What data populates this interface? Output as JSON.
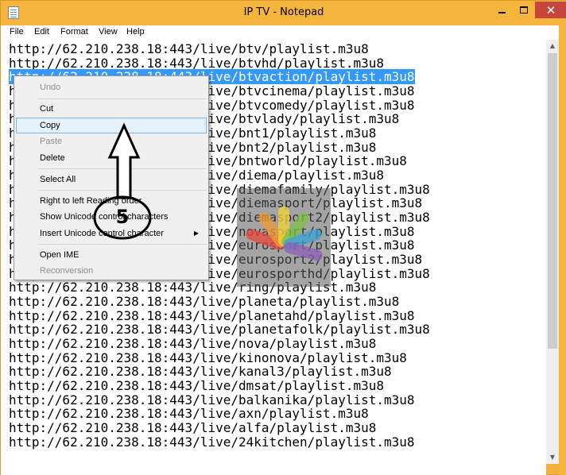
{
  "window": {
    "title": "IP TV - Notepad",
    "close_symbol": "✕"
  },
  "menubar": {
    "items": [
      "File",
      "Edit",
      "Format",
      "View",
      "Help"
    ]
  },
  "editor": {
    "selection": "http://62.210.238.18:443/live/btvaction/playlist.m3u8",
    "lines": [
      "http://62.210.238.18:443/live/btv/playlist.m3u8",
      "http://62.210.238.18:443/live/btvhd/playlist.m3u8",
      "http://62.210.238.18:443/live/btvaction/playlist.m3u8",
      "http://62.210.238.18:443/live/btvcinema/playlist.m3u8",
      "http://62.210.238.18:443/live/btvcomedy/playlist.m3u8",
      "http://62.210.238.18:443/live/btvlady/playlist.m3u8",
      "http://62.210.238.18:443/live/bnt1/playlist.m3u8",
      "http://62.210.238.18:443/live/bnt2/playlist.m3u8",
      "http://62.210.238.18:443/live/bntworld/playlist.m3u8",
      "http://62.210.238.18:443/live/diema/playlist.m3u8",
      "http://62.210.238.18:443/live/diemafamily/playlist.m3u8",
      "http://62.210.238.18:443/live/diemasport/playlist.m3u8",
      "http://62.210.238.18:443/live/diemasport2/playlist.m3u8",
      "http://62.210.238.18:443/live/novasport/playlist.m3u8",
      "http://62.210.238.18:443/live/eurosport/playlist.m3u8",
      "http://62.210.238.18:443/live/eurosport2/playlist.m3u8",
      "http://62.210.238.18:443/live/eurosporthd/playlist.m3u8",
      "http://62.210.238.18:443/live/ring/playlist.m3u8",
      "http://62.210.238.18:443/live/planeta/playlist.m3u8",
      "http://62.210.238.18:443/live/planetahd/playlist.m3u8",
      "http://62.210.238.18:443/live/planetafolk/playlist.m3u8",
      "http://62.210.238.18:443/live/nova/playlist.m3u8",
      "http://62.210.238.18:443/live/kinonova/playlist.m3u8",
      "http://62.210.238.18:443/live/kanal3/playlist.m3u8",
      "http://62.210.238.18:443/live/dmsat/playlist.m3u8",
      "http://62.210.238.18:443/live/balkanika/playlist.m3u8",
      "http://62.210.238.18:443/live/axn/playlist.m3u8",
      "http://62.210.238.18:443/live/alfa/playlist.m3u8",
      "http://62.210.238.18:443/live/24kitchen/playlist.m3u8"
    ]
  },
  "context_menu": {
    "items": [
      {
        "label": "Undo",
        "enabled": false
      },
      {
        "label": "Cut",
        "enabled": true
      },
      {
        "label": "Copy",
        "enabled": true,
        "highlighted": true
      },
      {
        "label": "Paste",
        "enabled": false
      },
      {
        "label": "Delete",
        "enabled": true
      },
      {
        "label": "Select All",
        "enabled": true
      },
      {
        "label": "Right to left Reading order",
        "enabled": true
      },
      {
        "label": "Show Unicode control characters",
        "enabled": true
      },
      {
        "label": "Insert Unicode control character",
        "enabled": true,
        "submenu": true
      },
      {
        "label": "Open IME",
        "enabled": true
      },
      {
        "label": "Reconversion",
        "enabled": false
      }
    ]
  },
  "annotation": {
    "step_number": "5"
  },
  "colors": {
    "title_bar": "#f5b43c",
    "selection": "#3399ff",
    "close_button": "#c7463b",
    "menu_highlight": "#e5f1fb"
  },
  "icons": {
    "app": "notepad-icon",
    "minimize": "minimize-icon",
    "maximize": "maximize-icon",
    "close": "close-icon",
    "scroll_up": "scroll-up-arrow-icon",
    "scroll_down": "scroll-down-arrow-icon",
    "submenu": "chevron-right-icon"
  }
}
